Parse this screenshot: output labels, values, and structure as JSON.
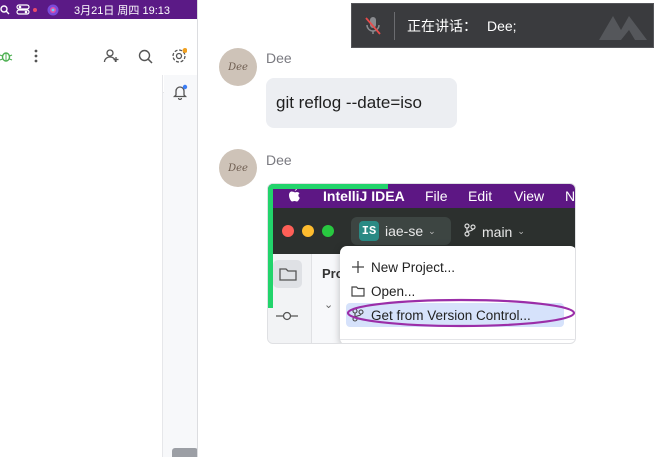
{
  "system_bar": {
    "date_time": "3月21日 周四 19:13"
  },
  "chat": {
    "messages": [
      {
        "sender": "Dee",
        "avatar_text": "Dee",
        "text": "git reflog --date=iso"
      },
      {
        "sender": "Dee",
        "avatar_text": "Dee",
        "type": "image"
      }
    ]
  },
  "speaking_overlay": {
    "label": "正在讲话：",
    "name": "Dee;"
  },
  "screenshot": {
    "menu": [
      "IntelliJ IDEA",
      "File",
      "Edit",
      "View",
      "N"
    ],
    "project_badge": "IS",
    "project_name": "iae-se",
    "branch": "main",
    "panel_label": "Pro",
    "dropdown_items": [
      {
        "label": "New Project...",
        "icon": "plus-icon"
      },
      {
        "label": "Open...",
        "icon": "folder-icon"
      },
      {
        "label": "Get from Version Control...",
        "icon": "vcs-icon"
      }
    ]
  },
  "colors": {
    "menubar_purple": "#5d1784",
    "annotation_purple": "#9b2ea8",
    "annotation_green": "#22d46b",
    "bubble_bg": "#eceef2"
  }
}
